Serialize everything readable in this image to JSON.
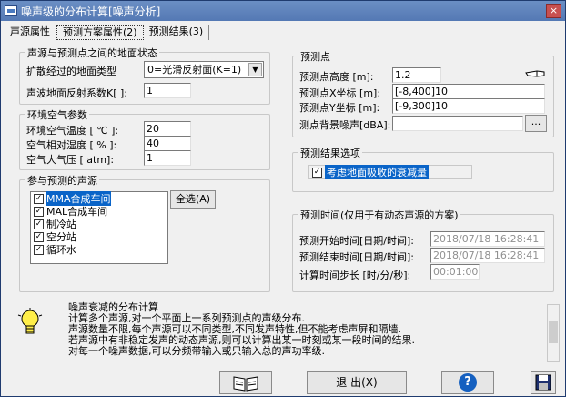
{
  "window": {
    "title": "噪声级的分布计算[噪声分析]",
    "close_label": "×"
  },
  "tabs": [
    "声源属性",
    "预测方案属性(2)",
    "预测结果(3)"
  ],
  "ground": {
    "title": "声源与预测点之间的地面状态",
    "terrain_label": "扩散经过的地面类型",
    "terrain_value": "0=光滑反射面(K=1)",
    "reflect_label": "声波地面反射系数K[ ]:",
    "reflect_value": "1"
  },
  "air": {
    "title": "环境空气参数",
    "temp_label": "环境空气温度  [ ℃ ]:",
    "temp_value": "20",
    "humidity_label": "空气相对湿度  [ % ]:",
    "humidity_value": "40",
    "pressure_label": "空气大气压  [ atm]:",
    "pressure_value": "1"
  },
  "sources": {
    "title": "参与预测的声源",
    "select_all": "全选(A)",
    "items": [
      "MMA合成车间",
      "MAL合成车间",
      "制冷站",
      "空分站",
      "循环水"
    ]
  },
  "point": {
    "title": "预测点",
    "height_label": "预测点高度  [m]:",
    "height_value": "1.2",
    "x_label": "预测点X坐标 [m]:",
    "x_value": "[-8,400]10",
    "y_label": "预测点Y坐标 [m]:",
    "y_value": "[-9,300]10",
    "bg_label": "测点背景噪声[dBA]:",
    "bg_value": "",
    "browse": "..."
  },
  "options": {
    "title": "预测结果选项",
    "attenuation_label": "考虑地面吸收的衰减量"
  },
  "time": {
    "title": "预测时间(仅用于有动态声源的方案)",
    "start_label": "预测开始时间[日期/时间]:",
    "start_value": "2018/07/18 16:28:41",
    "end_label": "预测结束时间[日期/时间]:",
    "end_value": "2018/07/18 16:28:41",
    "step_label": "计算时间步长 [时/分/秒]:",
    "step_value": "00:01:00"
  },
  "info": {
    "lines": [
      "噪声衰减的分布计算",
      "计算多个声源,对一个平面上一系列预测点的声级分布.",
      "声源数量不限,每个声源可以不同类型,不同发声特性,但不能考虑声屏和隔墙.",
      "若声源中有非稳定发声的动态声源,则可以计算出某一时刻或某一段时间的结果.",
      "对每一个噪声数据,可以分频带输入或只输入总的声功率级."
    ]
  },
  "footer": {
    "exit": "退 出(X)",
    "help": "?"
  }
}
